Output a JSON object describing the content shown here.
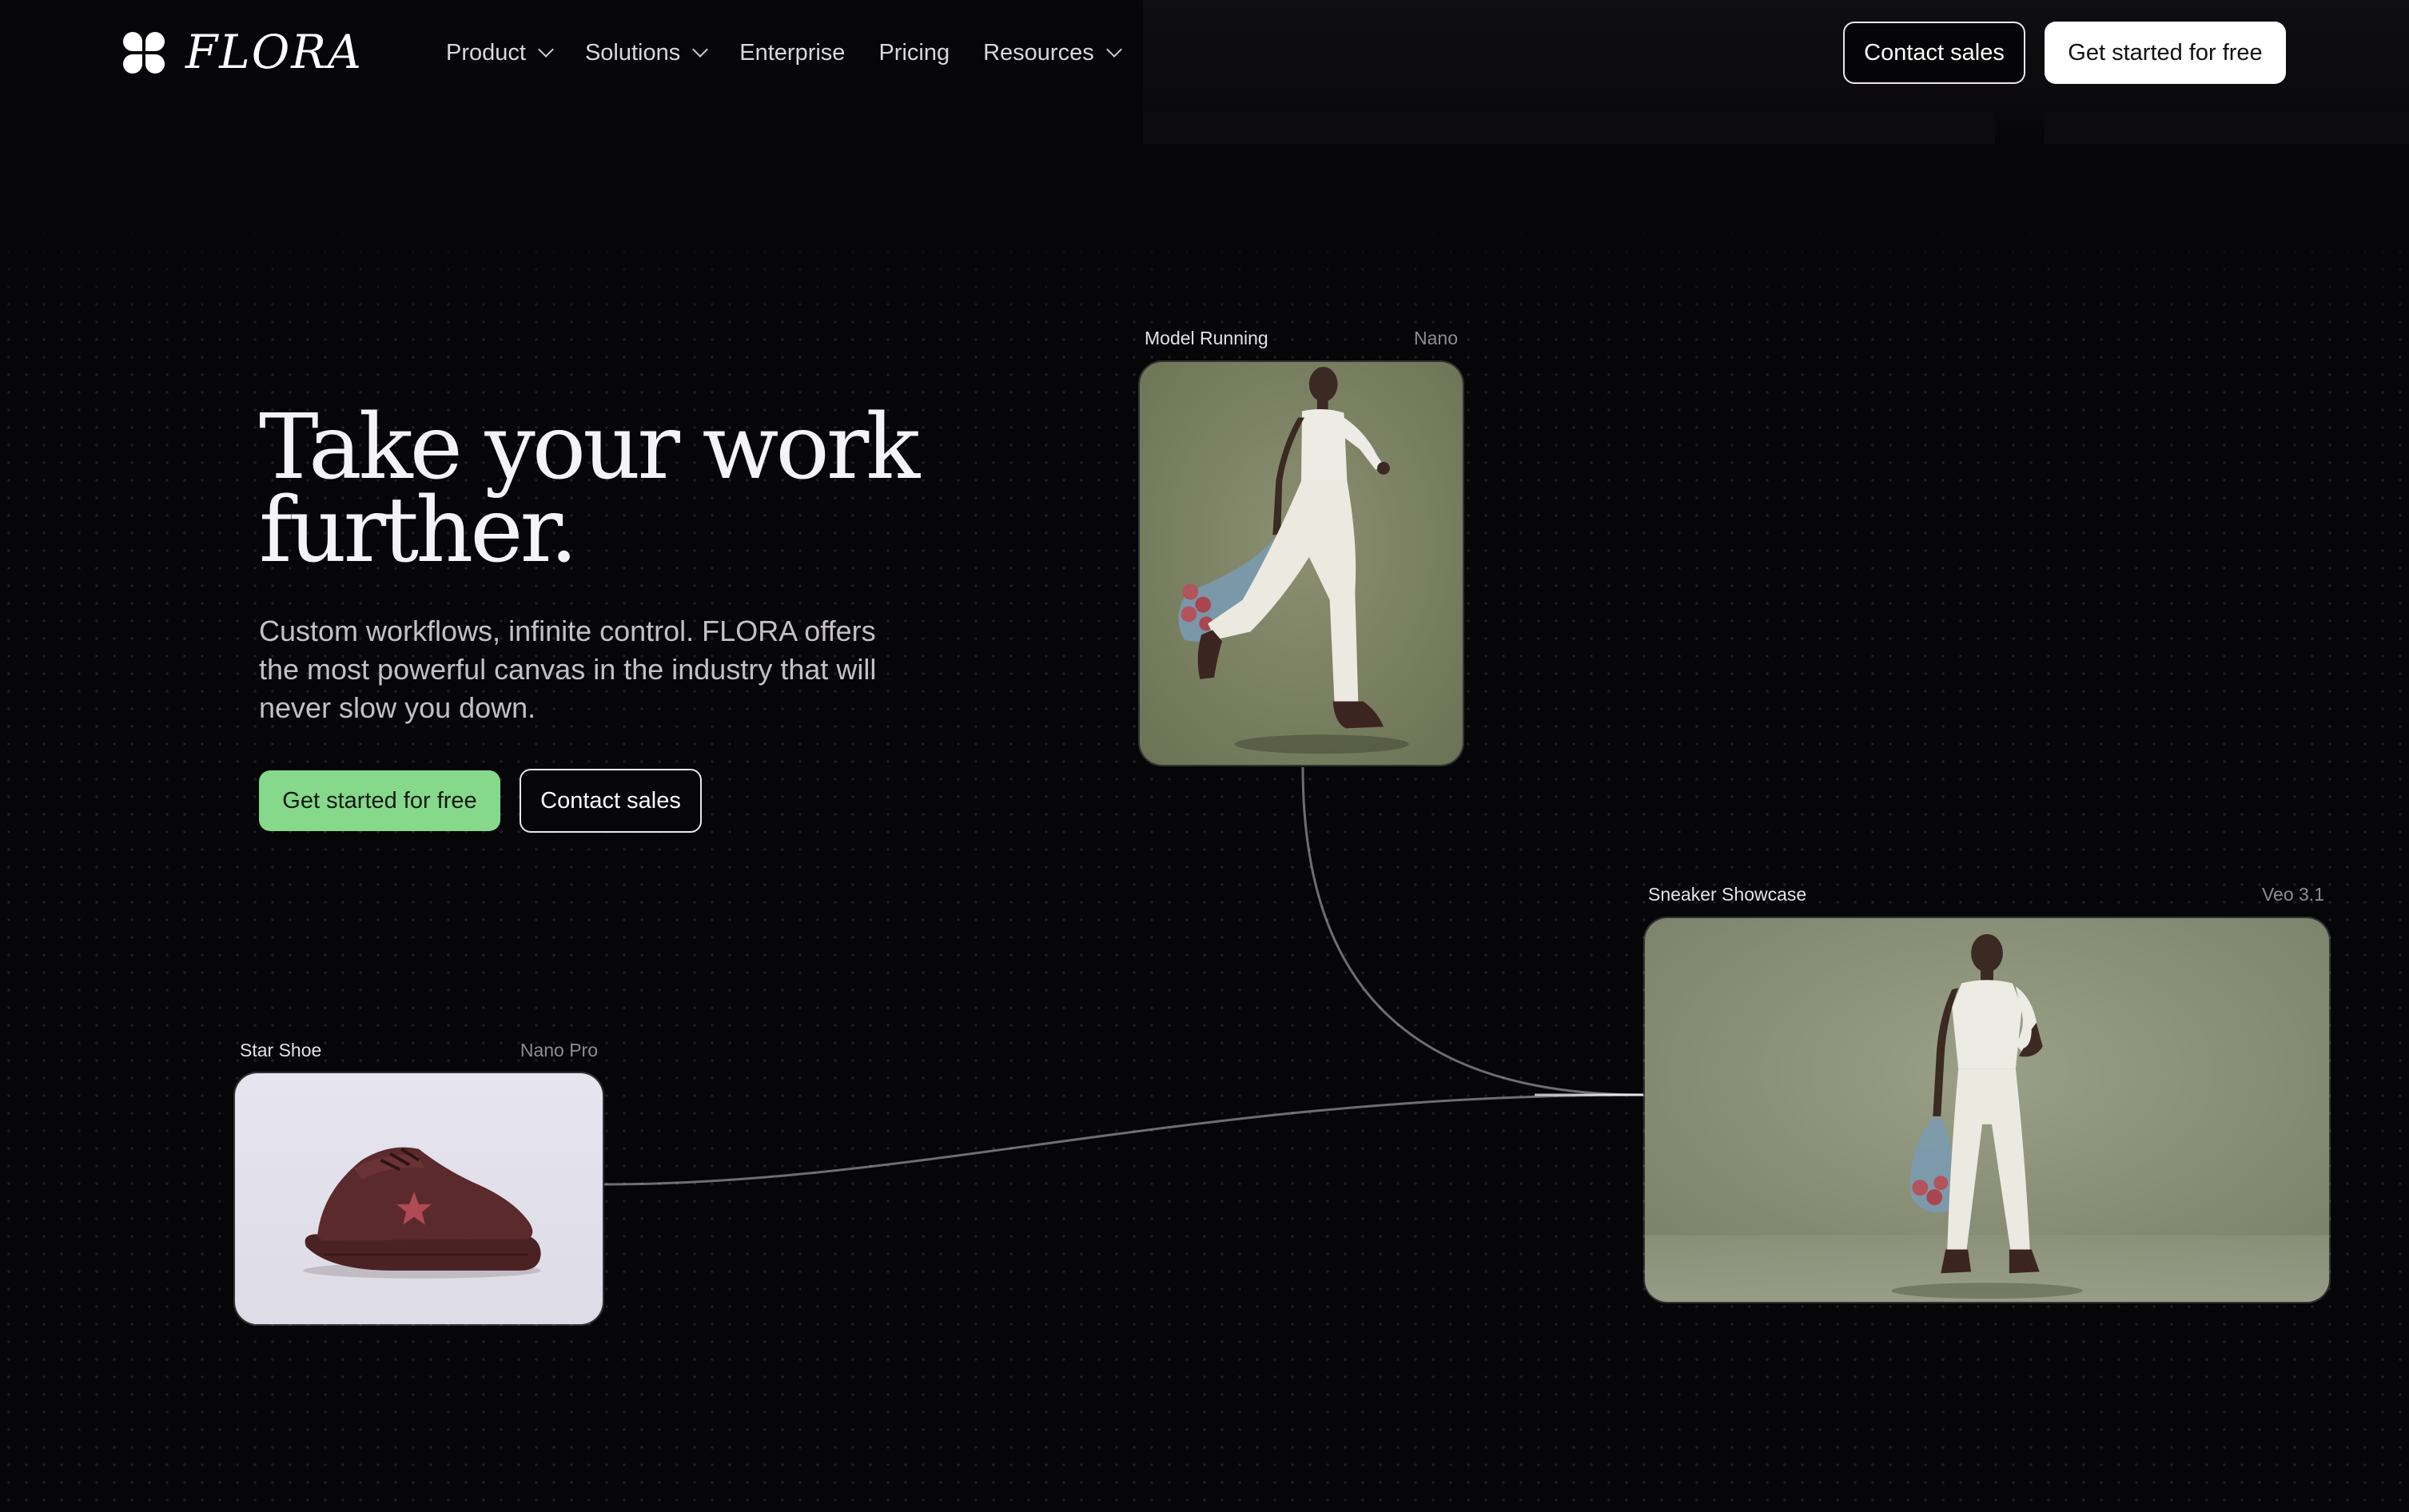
{
  "nav": {
    "brand": "FLORA",
    "links": [
      {
        "label": "Product",
        "has_dropdown": true
      },
      {
        "label": "Solutions",
        "has_dropdown": true
      },
      {
        "label": "Enterprise",
        "has_dropdown": false
      },
      {
        "label": "Pricing",
        "has_dropdown": false
      },
      {
        "label": "Resources",
        "has_dropdown": true
      }
    ],
    "contact_label": "Contact sales",
    "cta_label": "Get started for free"
  },
  "hero": {
    "title_line1": "Take your work",
    "title_line2": "further.",
    "subtitle": "Custom workflows, infinite control. FLORA offers the most powerful canvas in the industry that will never slow you down.",
    "primary_cta": "Get started for free",
    "secondary_cta": "Contact sales"
  },
  "nodes": [
    {
      "title": "Model Running",
      "model": "Nano"
    },
    {
      "title": "Sneaker Showcase",
      "model": "Veo 3.1"
    },
    {
      "title": "Star Shoe",
      "model": "Nano Pro"
    }
  ],
  "colors": {
    "background": "#060508",
    "accent_green": "#86d98a",
    "card_olive": "#7d8463",
    "card_lavender": "#e4e2ec"
  }
}
